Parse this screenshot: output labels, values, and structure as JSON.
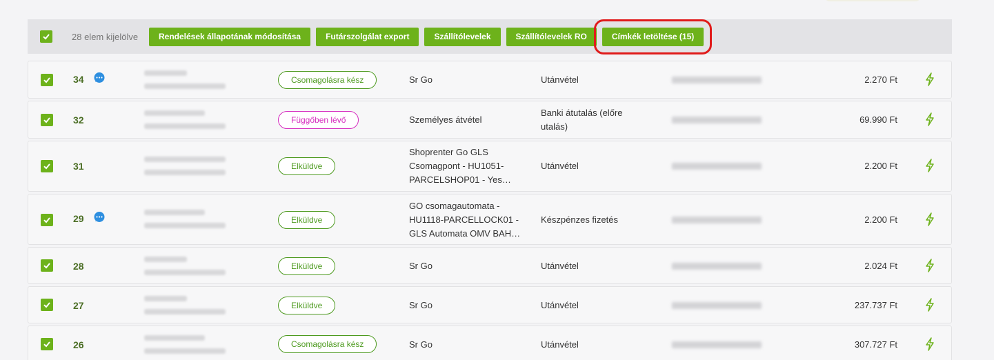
{
  "bulk": {
    "selected_label": "28 elem kijelölve",
    "actions": [
      "Rendelések állapotának módosítása",
      "Futárszolgálat export",
      "Szállítólevelek",
      "Szállítólevelek RO",
      "Címkék letöltése (15)"
    ]
  },
  "orders": [
    {
      "id": "34",
      "status": "Csomagolásra kész",
      "shipping": "Sr Go",
      "payment": "Utánvétel",
      "total": "2.270 Ft"
    },
    {
      "id": "32",
      "status": "Függőben lévő",
      "shipping": "Személyes átvétel",
      "payment": "Banki átutalás (előre utalás)",
      "total": "69.990 Ft"
    },
    {
      "id": "31",
      "status": "Elküldve",
      "shipping": "Shoprenter Go GLS Csomagpont - HU1051-PARCELSHOP01 - Yes…",
      "payment": "Utánvétel",
      "total": "2.200 Ft"
    },
    {
      "id": "29",
      "status": "Elküldve",
      "shipping": "GO csomagautomata - HU1118-PARCELLOCK01 - GLS Automata OMV BAH…",
      "payment": "Készpénzes fizetés",
      "total": "2.200 Ft"
    },
    {
      "id": "28",
      "status": "Elküldve",
      "shipping": "Sr Go",
      "payment": "Utánvétel",
      "total": "2.024 Ft"
    },
    {
      "id": "27",
      "status": "Elküldve",
      "shipping": "Sr Go",
      "payment": "Utánvétel",
      "total": "237.737 Ft"
    },
    {
      "id": "26",
      "status": "Csomagolásra kész",
      "shipping": "Sr Go",
      "payment": "Utánvétel",
      "total": "307.727 Ft"
    }
  ],
  "colors": {
    "accent": "#6db21b",
    "highlight": "#e01b1b",
    "pending": "#d62cbf",
    "chat": "#2e8fe0"
  },
  "icons": {
    "checkbox": "check-icon",
    "chat": "chat-bubble-icon",
    "quick_action": "lightning-icon"
  }
}
